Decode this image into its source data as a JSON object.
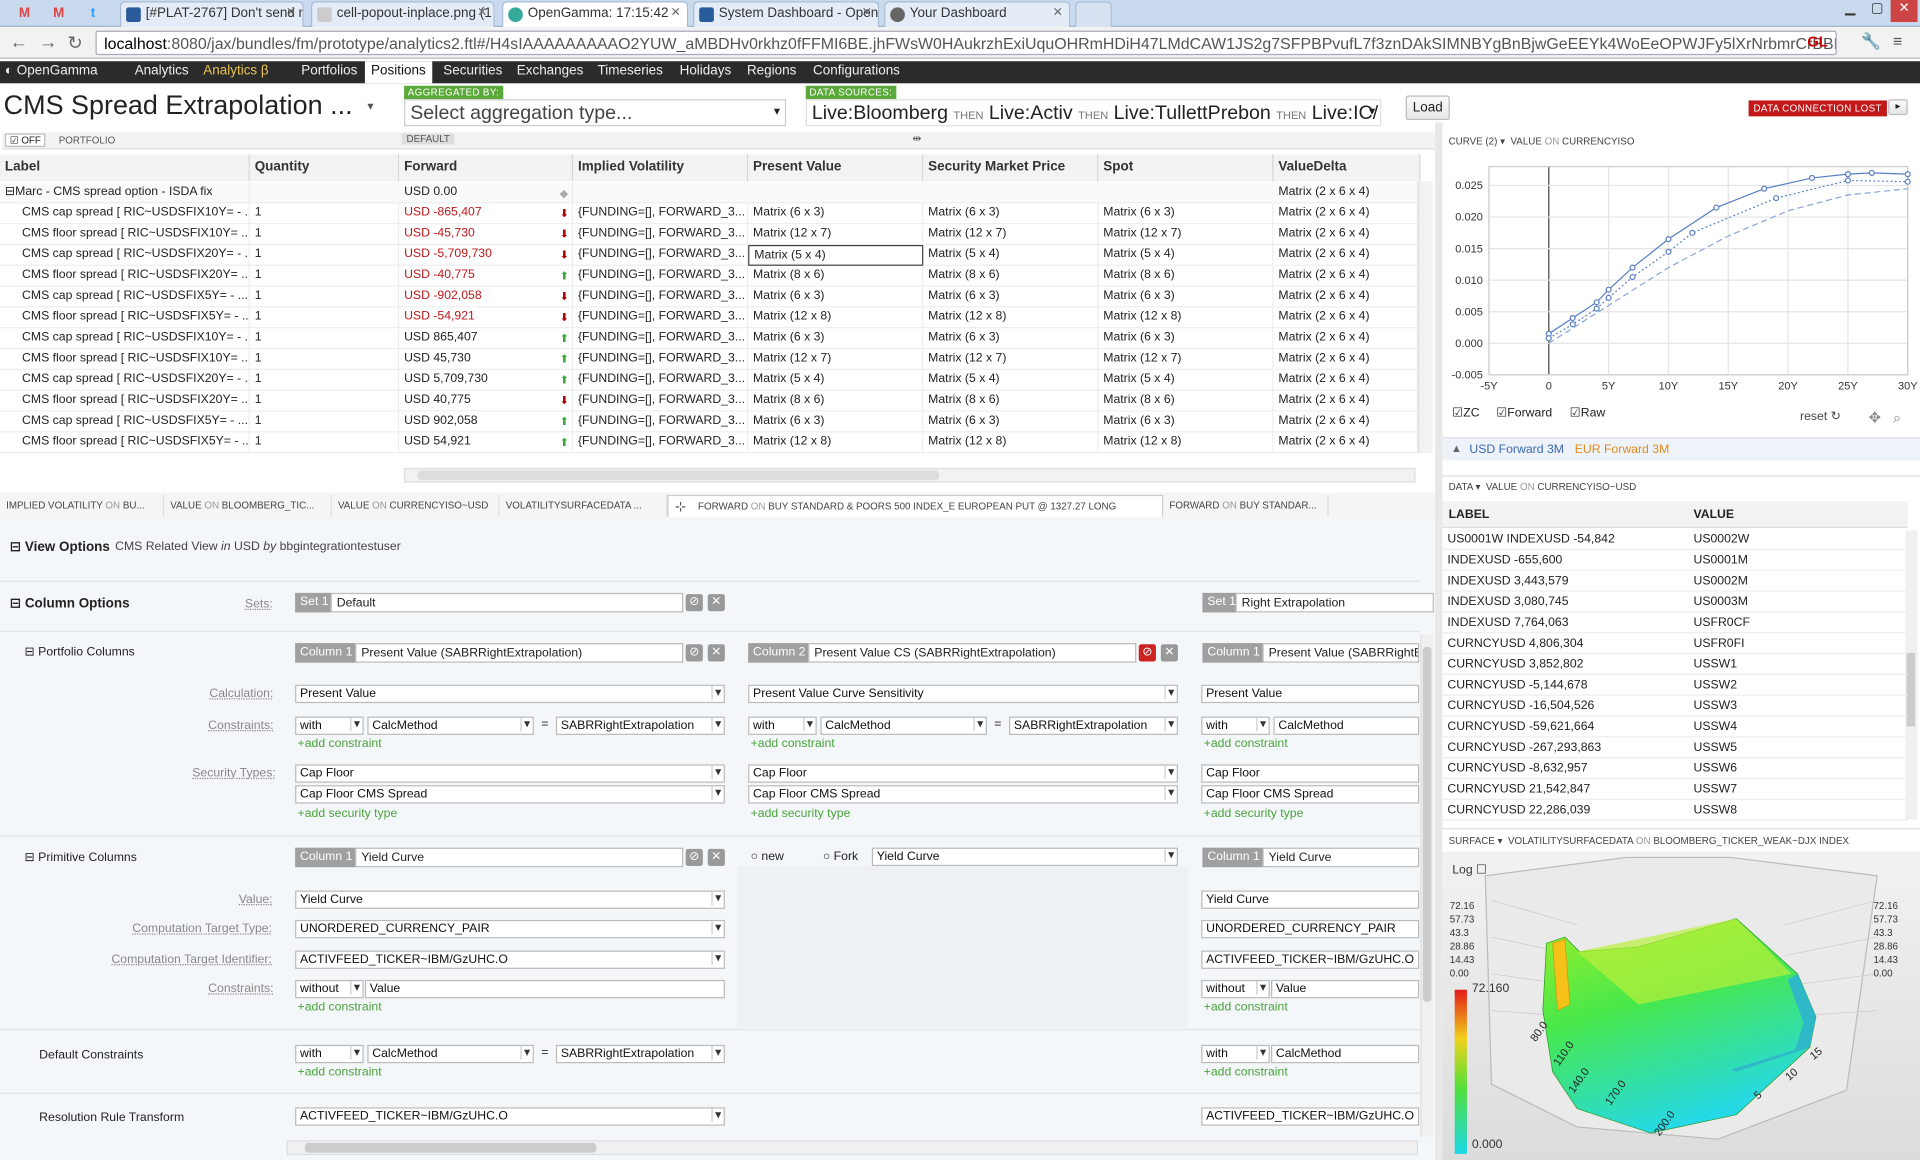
{
  "browser": {
    "pinned_tabs": [
      "M",
      "M",
      "t"
    ],
    "tabs": [
      {
        "label": "[#PLAT-2767] Don't send n"
      },
      {
        "label": "cell-popout-inplace.png (1"
      },
      {
        "label": "OpenGamma: 17:15:42",
        "active": true
      },
      {
        "label": "System Dashboard - Open"
      },
      {
        "label": "Your Dashboard"
      }
    ],
    "url_host": "localhost",
    "url_rest": ":8080/jax/bundles/fm/prototype/analytics2.ftl#/H4sIAAAAAAAAAO2YUW_aMBDHv0rkhz0fFFMI6BE.jhFWsW0HAukrzhExiUquOHRmHDiH47LMdCAW1JS2g7SFPBPvufL7f3znDAkSIMNBYgBnBjwGeEEYk4WoEeOPWJFy5lXrNrbmrCrBBLPiMBFhMQePXQJ",
    "url_suffix": "GL"
  },
  "app": {
    "menu": [
      "OpenGamma",
      "Analytics",
      "Analytics β",
      "Portfolios",
      "Positions",
      "Securities",
      "Exchanges",
      "Timeseries",
      "Holidays",
      "Regions",
      "Configurations"
    ],
    "title": "CMS Spread Extrapolation ...",
    "aggregated_by_label": "AGGREGATED BY:",
    "aggregation_placeholder": "Select aggregation type...",
    "data_sources_label": "DATA SOURCES:",
    "data_sources": [
      "Live:Bloomberg",
      "Live:Activ",
      "Live:TullettPrebon",
      "Live:IC/"
    ],
    "then_word": "THEN",
    "load_label": "Load",
    "connection_lost": "DATA CONNECTION LOST"
  },
  "grid": {
    "off_label": "OFF",
    "portfolio_label": "PORTFOLIO",
    "default_label": "DEFAULT",
    "columns": [
      "Label",
      "Quantity",
      "Forward",
      "Implied Volatility",
      "Present Value",
      "Security Market Price",
      "Spot",
      "ValueDelta"
    ],
    "group": {
      "label": "Marc - CMS spread option - ISDA fix",
      "forward": "USD 0.00",
      "delta": "Matrix (2 x 6 x 4)"
    },
    "rows": [
      {
        "label": "CMS cap spread [ RIC~USDSFIX10Y= - ...",
        "qty": "1",
        "fwd": "USD -865,407",
        "neg": true,
        "dir": "down",
        "vol": "{FUNDING=[], FORWARD_3...",
        "pv": "Matrix (6 x 3)",
        "smp": "Matrix (6 x 3)",
        "spot": "Matrix (6 x 3)",
        "delta": "Matrix (2 x 6 x 4)"
      },
      {
        "label": "CMS floor spread [ RIC~USDSFIX10Y= ...",
        "qty": "1",
        "fwd": "USD -45,730",
        "neg": true,
        "dir": "down",
        "vol": "{FUNDING=[], FORWARD_3...",
        "pv": "Matrix (12 x 7)",
        "smp": "Matrix (12 x 7)",
        "spot": "Matrix (12 x 7)",
        "delta": "Matrix (2 x 6 x 4)"
      },
      {
        "label": "CMS cap spread [ RIC~USDSFIX20Y= - ...",
        "qty": "1",
        "fwd": "USD -5,709,730",
        "neg": true,
        "dir": "down",
        "vol": "{FUNDING=[], FORWARD_3...",
        "pv": "Matrix (5 x 4)",
        "smp": "Matrix (5 x 4)",
        "spot": "Matrix (5 x 4)",
        "delta": "Matrix (2 x 6 x 4)"
      },
      {
        "label": "CMS floor spread [ RIC~USDSFIX20Y= ...",
        "qty": "1",
        "fwd": "USD -40,775",
        "neg": true,
        "dir": "up",
        "vol": "{FUNDING=[], FORWARD_3...",
        "pv": "Matrix (8 x 6)",
        "smp": "Matrix (8 x 6)",
        "spot": "Matrix (8 x 6)",
        "delta": "Matrix (2 x 6 x 4)"
      },
      {
        "label": "CMS cap spread [ RIC~USDSFIX5Y= - ...",
        "qty": "1",
        "fwd": "USD -902,058",
        "neg": true,
        "dir": "down",
        "vol": "{FUNDING=[], FORWARD_3...",
        "pv": "Matrix (6 x 3)",
        "smp": "Matrix (6 x 3)",
        "spot": "Matrix (6 x 3)",
        "delta": "Matrix (2 x 6 x 4)"
      },
      {
        "label": "CMS floor spread [ RIC~USDSFIX5Y= - ...",
        "qty": "1",
        "fwd": "USD -54,921",
        "neg": true,
        "dir": "down",
        "vol": "{FUNDING=[], FORWARD_3...",
        "pv": "Matrix (12 x 8)",
        "smp": "Matrix (12 x 8)",
        "spot": "Matrix (12 x 8)",
        "delta": "Matrix (2 x 6 x 4)"
      },
      {
        "label": "CMS cap spread [ RIC~USDSFIX10Y= - ...",
        "qty": "1",
        "fwd": "USD 865,407",
        "neg": false,
        "dir": "up",
        "vol": "{FUNDING=[], FORWARD_3...",
        "pv": "Matrix (6 x 3)",
        "smp": "Matrix (6 x 3)",
        "spot": "Matrix (6 x 3)",
        "delta": "Matrix (2 x 6 x 4)"
      },
      {
        "label": "CMS floor spread [ RIC~USDSFIX10Y= ...",
        "qty": "1",
        "fwd": "USD 45,730",
        "neg": false,
        "dir": "up",
        "vol": "{FUNDING=[], FORWARD_3...",
        "pv": "Matrix (12 x 7)",
        "smp": "Matrix (12 x 7)",
        "spot": "Matrix (12 x 7)",
        "delta": "Matrix (2 x 6 x 4)"
      },
      {
        "label": "CMS cap spread [ RIC~USDSFIX20Y= - ...",
        "qty": "1",
        "fwd": "USD 5,709,730",
        "neg": false,
        "dir": "up",
        "vol": "{FUNDING=[], FORWARD_3...",
        "pv": "Matrix (5 x 4)",
        "smp": "Matrix (5 x 4)",
        "spot": "Matrix (5 x 4)",
        "delta": "Matrix (2 x 6 x 4)"
      },
      {
        "label": "CMS floor spread [ RIC~USDSFIX20Y= ...",
        "qty": "1",
        "fwd": "USD 40,775",
        "neg": false,
        "dir": "down",
        "vol": "{FUNDING=[], FORWARD_3...",
        "pv": "Matrix (8 x 6)",
        "smp": "Matrix (8 x 6)",
        "spot": "Matrix (8 x 6)",
        "delta": "Matrix (2 x 6 x 4)"
      },
      {
        "label": "CMS cap spread [ RIC~USDSFIX5Y= - ...",
        "qty": "1",
        "fwd": "USD 902,058",
        "neg": false,
        "dir": "up",
        "vol": "{FUNDING=[], FORWARD_3...",
        "pv": "Matrix (6 x 3)",
        "smp": "Matrix (6 x 3)",
        "spot": "Matrix (6 x 3)",
        "delta": "Matrix (2 x 6 x 4)"
      },
      {
        "label": "CMS floor spread [ RIC~USDSFIX5Y= - ...",
        "qty": "1",
        "fwd": "USD 54,921",
        "neg": false,
        "dir": "up",
        "vol": "{FUNDING=[], FORWARD_3...",
        "pv": "Matrix (12 x 8)",
        "smp": "Matrix (12 x 8)",
        "spot": "Matrix (12 x 8)",
        "delta": "Matrix (2 x 6 x 4)"
      }
    ]
  },
  "view_tabs": [
    {
      "k1": "IMPLIED VOLATILITY",
      "on": "ON",
      "k2": "BU..."
    },
    {
      "k1": "VALUE",
      "on": "ON",
      "k2": "BLOOMBERG_TIC..."
    },
    {
      "k1": "VALUE",
      "on": "ON",
      "k2": "CURRENCYISO~USD"
    },
    {
      "k1": "VOLATILITYSURFACEDATA",
      "on": "",
      "k2": "..."
    },
    {
      "k1": "FORWARD",
      "on": "ON",
      "k2": "BUY STANDARD & POORS 500 INDEX_E EUROPEAN PUT @ 1327.27 LONG"
    },
    {
      "k1": "FORWARD",
      "on": "ON",
      "k2": "BUY STANDAR..."
    }
  ],
  "options": {
    "view_options": "View Options",
    "view_desc_a": "CMS Related View",
    "view_desc_in": "in",
    "view_desc_b": "USD",
    "view_desc_by": "by",
    "view_desc_user": "bbgintegrationtestuser",
    "column_options": "Column Options",
    "sets_label": "Sets:",
    "set1_tag": "Set 1",
    "set1_name": "Default",
    "set1b_name": "Right Extrapolation",
    "portfolio_columns": "Portfolio Columns",
    "col1_tag": "Column 1",
    "col1_name": "Present Value (SABRRightExtrapolation)",
    "col2_tag": "Column 2",
    "col2_name": "Present Value CS (SABRRightExtrapolation)",
    "col1b_name": "Present Value (SABRRightE",
    "calculation_label": "Calculation:",
    "calc1": "Present Value",
    "calc2": "Present Value Curve Sensitivity",
    "constraints_label": "Constraints:",
    "with": "with",
    "without": "without",
    "calcmethod": "CalcMethod",
    "sabr": "SABRRightExtrapolation",
    "add_constraint": "+add constraint",
    "security_types_label": "Security Types:",
    "sec1": "Cap Floor",
    "sec2": "Cap Floor CMS Spread",
    "add_security_type": "+add security type",
    "primitive_columns": "Primitive Columns",
    "prim_name": "Yield Curve",
    "new_label": "new",
    "fork_label": "Fork",
    "value_label": "Value:",
    "value_val": "Yield Curve",
    "ctt_label": "Computation Target Type:",
    "ctt_val": "UNORDERED_CURRENCY_PAIR",
    "cti_label": "Computation Target Identifier:",
    "cti_val": "ACTIVFEED_TICKER~IBM/GzUHC.O",
    "value_word": "Value",
    "default_constraints": "Default Constraints",
    "resolution_rule": "Resolution Rule Transform",
    "rrt_val": "ACTIVFEED_TICKER~IBM/GzUHC.O",
    "equals": "="
  },
  "curve_panel": {
    "title_a": "CURVE (2)",
    "title_on_a": "VALUE",
    "title_on": "ON",
    "title_b": "CURRENCYISO",
    "checks": [
      "ZC",
      "Forward",
      "Raw"
    ],
    "reset_label": "reset",
    "legend": [
      "USD Forward 3M",
      "EUR Forward 3M"
    ]
  },
  "chart_data": {
    "type": "line",
    "title": "",
    "xlabel": "",
    "ylabel": "",
    "x_ticks": [
      "-5Y",
      "0",
      "5Y",
      "10Y",
      "15Y",
      "20Y",
      "25Y",
      "30Y"
    ],
    "y_ticks": [
      "-0.005",
      "0.000",
      "0.005",
      "0.010",
      "0.015",
      "0.020",
      "0.025"
    ],
    "xlim": [
      -5,
      30
    ],
    "ylim": [
      -0.005,
      0.028
    ],
    "series": [
      {
        "name": "USD Forward 3M",
        "style": "solid",
        "color": "#5a7fc4",
        "x": [
          0,
          2,
          4,
          5,
          7,
          10,
          14,
          18,
          22,
          25,
          27,
          30
        ],
        "values": [
          0.0015,
          0.004,
          0.0065,
          0.0085,
          0.012,
          0.0165,
          0.0215,
          0.0245,
          0.0262,
          0.0268,
          0.027,
          0.0268
        ]
      },
      {
        "name": "Raw",
        "style": "dotted",
        "color": "#5a7fc4",
        "x": [
          0,
          2,
          4,
          5,
          7,
          10,
          12,
          19,
          25,
          30
        ],
        "values": [
          0.0008,
          0.003,
          0.0055,
          0.0072,
          0.0105,
          0.0145,
          0.0175,
          0.023,
          0.0258,
          0.0256
        ]
      },
      {
        "name": "",
        "style": "dashed",
        "color": "#8aa6d8",
        "x": [
          0,
          5,
          10,
          15,
          20,
          25,
          30
        ],
        "values": [
          0.0,
          0.006,
          0.012,
          0.017,
          0.021,
          0.0235,
          0.0245
        ]
      }
    ],
    "grid": true
  },
  "data_panel": {
    "title_a": "DATA",
    "title_b": "VALUE",
    "title_on": "ON",
    "title_c": "CURRENCYISO~USD",
    "headers": [
      "LABEL",
      "VALUE"
    ],
    "rows": [
      [
        "US0001W INDEXUSD -54,842",
        "US0002W"
      ],
      [
        "INDEXUSD -655,600",
        "US0001M"
      ],
      [
        "INDEXUSD 3,443,579",
        "US0002M"
      ],
      [
        "INDEXUSD 3,080,745",
        "US0003M"
      ],
      [
        "INDEXUSD 7,764,063",
        "USFR0CF"
      ],
      [
        "CURNCYUSD 4,806,304",
        "USFR0FI"
      ],
      [
        "CURNCYUSD 3,852,802",
        "USSW1"
      ],
      [
        "CURNCYUSD -5,144,678",
        "USSW2"
      ],
      [
        "CURNCYUSD -16,504,526",
        "USSW3"
      ],
      [
        "CURNCYUSD -59,621,664",
        "USSW4"
      ],
      [
        "CURNCYUSD -267,293,863",
        "USSW5"
      ],
      [
        "CURNCYUSD -8,632,957",
        "USSW6"
      ],
      [
        "CURNCYUSD 21,542,847",
        "USSW7"
      ],
      [
        "CURNCYUSD 22,286,039",
        "USSW8"
      ]
    ]
  },
  "surface_panel": {
    "title_a": "SURFACE",
    "title_b": "VOLATILITYSURFACEDATA",
    "title_on": "ON",
    "title_c": "BLOOMBERG_TICKER_WEAK~DJX INDEX",
    "log_label": "Log",
    "scale_max": "72.160",
    "scale_min": "0.000",
    "side_ticks": [
      "72.16",
      "57.73",
      "43.3",
      "28.86",
      "14.43",
      "0.00"
    ],
    "x_ticks": [
      "80.0",
      "110.0",
      "140.0",
      "170.0",
      "200.0"
    ],
    "z_ticks": [
      "5",
      "10",
      "15"
    ]
  }
}
